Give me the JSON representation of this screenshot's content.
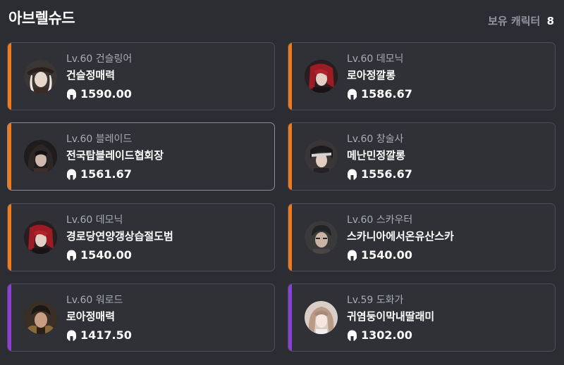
{
  "header": {
    "server_name": "아브렐슈드",
    "char_count_label": "보유 캐릭터",
    "char_count": "8"
  },
  "accent_colors": {
    "orange": "#f07a1e",
    "purple": "#8a3fd9"
  },
  "characters": [
    {
      "level_class": "Lv.60 건슬링어",
      "name": "건슬정매력",
      "item_level": "1590.00",
      "accent": "orange",
      "avatar_icon": "gunslinger-portrait"
    },
    {
      "level_class": "Lv.60 데모닉",
      "name": "로아정깔롱",
      "item_level": "1586.67",
      "accent": "orange",
      "avatar_icon": "demonic-portrait"
    },
    {
      "level_class": "Lv.60 블레이드",
      "name": "전국탑블레이드협회장",
      "item_level": "1561.67",
      "accent": "orange",
      "avatar_icon": "blade-portrait"
    },
    {
      "level_class": "Lv.60 창술사",
      "name": "메난민정깔롱",
      "item_level": "1556.67",
      "accent": "orange",
      "avatar_icon": "lancemaster-portrait"
    },
    {
      "level_class": "Lv.60 데모닉",
      "name": "경로당연양갱상습절도범",
      "item_level": "1540.00",
      "accent": "orange",
      "avatar_icon": "demonic-portrait"
    },
    {
      "level_class": "Lv.60 스카우터",
      "name": "스카니아에서온유산스카",
      "item_level": "1540.00",
      "accent": "orange",
      "avatar_icon": "scouter-portrait"
    },
    {
      "level_class": "Lv.60 워로드",
      "name": "로아정매력",
      "item_level": "1417.50",
      "accent": "purple",
      "avatar_icon": "warlord-portrait"
    },
    {
      "level_class": "Lv.59 도화가",
      "name": "귀염둥이막내딸래미",
      "item_level": "1302.00",
      "accent": "purple",
      "avatar_icon": "artist-portrait"
    }
  ]
}
